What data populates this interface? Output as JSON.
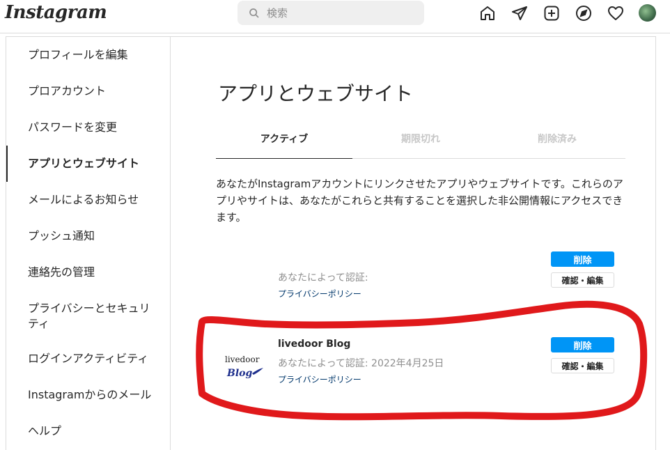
{
  "header": {
    "logo": "Instagram",
    "search_placeholder": "検索"
  },
  "sidebar": {
    "items": [
      {
        "label": "プロフィールを編集"
      },
      {
        "label": "プロアカウント"
      },
      {
        "label": "パスワードを変更"
      },
      {
        "label": "アプリとウェブサイト",
        "active": true
      },
      {
        "label": "メールによるお知らせ"
      },
      {
        "label": "プッシュ通知"
      },
      {
        "label": "連絡先の管理"
      },
      {
        "label": "プライバシーとセキュリティ"
      },
      {
        "label": "ログインアクティビティ"
      },
      {
        "label": "Instagramからのメール"
      },
      {
        "label": "ヘルプ"
      }
    ]
  },
  "main": {
    "title": "アプリとウェブサイト",
    "tabs": [
      {
        "label": "アクティブ",
        "active": true
      },
      {
        "label": "期限切れ"
      },
      {
        "label": "削除済み"
      }
    ],
    "description": "あなたがInstagramアカウントにリンクさせたアプリやウェブサイトです。これらのアプリやサイトは、あなたがこれらと共有することを選択した非公開情報にアクセスできます。",
    "apps": [
      {
        "name": "",
        "auth_text": "あなたによって認証:",
        "policy_label": "プライバシーポリシー",
        "delete_label": "削除",
        "edit_label": "確認・編集"
      },
      {
        "name": "livedoor Blog",
        "logo_text_top": "livedoor",
        "logo_text_bottom": "Blog",
        "auth_text": "あなたによって認証: 2022年4月25日",
        "policy_label": "プライバシーポリシー",
        "delete_label": "削除",
        "edit_label": "確認・編集"
      }
    ]
  },
  "colors": {
    "accent": "#0095f6",
    "link": "#00376b",
    "annotation": "#e0191b"
  }
}
